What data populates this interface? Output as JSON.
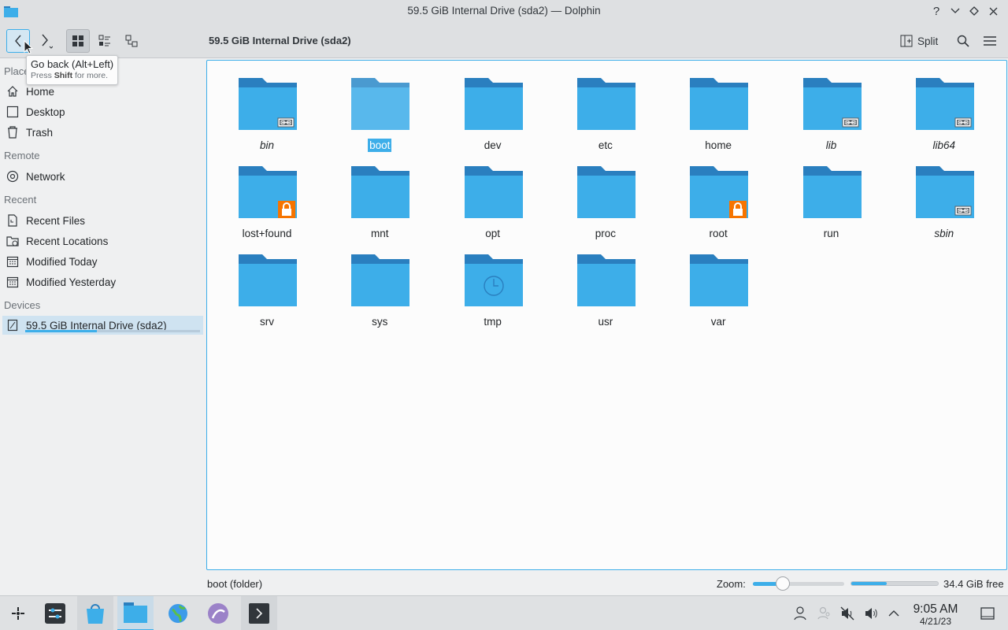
{
  "window": {
    "title": "59.5 GiB Internal Drive (sda2) — Dolphin",
    "help_glyph": "?"
  },
  "toolbar": {
    "breadcrumb": "59.5 GiB Internal Drive (sda2)",
    "split_label": "Split"
  },
  "tooltip": {
    "line1": "Go back (Alt+Left)",
    "line2_pre": "Press ",
    "line2_bold": "Shift",
    "line2_post": " for more."
  },
  "sidebar": {
    "places_header": "Places",
    "places": [
      {
        "label": "Home",
        "icon": "home-icon"
      },
      {
        "label": "Desktop",
        "icon": "desktop-icon"
      },
      {
        "label": "Trash",
        "icon": "trash-icon"
      }
    ],
    "remote_header": "Remote",
    "remote": [
      {
        "label": "Network",
        "icon": "network-icon"
      }
    ],
    "recent_header": "Recent",
    "recent": [
      {
        "label": "Recent Files",
        "icon": "recent-files-icon"
      },
      {
        "label": "Recent Locations",
        "icon": "recent-locations-icon"
      },
      {
        "label": "Modified Today",
        "icon": "calendar-icon"
      },
      {
        "label": "Modified Yesterday",
        "icon": "calendar-icon"
      }
    ],
    "devices_header": "Devices",
    "devices": [
      {
        "label": "59.5 GiB Internal Drive (sda2)",
        "icon": "drive-icon",
        "used_fraction": 0.41
      }
    ]
  },
  "folders": [
    {
      "name": "bin",
      "badge": "symlink",
      "italic": true
    },
    {
      "name": "boot",
      "badge": "",
      "italic": false,
      "selected": true
    },
    {
      "name": "dev",
      "badge": "",
      "italic": false
    },
    {
      "name": "etc",
      "badge": "",
      "italic": false
    },
    {
      "name": "home",
      "badge": "",
      "italic": false
    },
    {
      "name": "lib",
      "badge": "symlink",
      "italic": true
    },
    {
      "name": "lib64",
      "badge": "symlink",
      "italic": true
    },
    {
      "name": "lost+found",
      "badge": "lock",
      "italic": false
    },
    {
      "name": "mnt",
      "badge": "",
      "italic": false
    },
    {
      "name": "opt",
      "badge": "",
      "italic": false
    },
    {
      "name": "proc",
      "badge": "",
      "italic": false
    },
    {
      "name": "root",
      "badge": "lock",
      "italic": false
    },
    {
      "name": "run",
      "badge": "",
      "italic": false
    },
    {
      "name": "sbin",
      "badge": "symlink",
      "italic": true
    },
    {
      "name": "srv",
      "badge": "",
      "italic": false
    },
    {
      "name": "sys",
      "badge": "",
      "italic": false
    },
    {
      "name": "tmp",
      "badge": "clock",
      "italic": false
    },
    {
      "name": "usr",
      "badge": "",
      "italic": false
    },
    {
      "name": "var",
      "badge": "",
      "italic": false
    }
  ],
  "statusbar": {
    "selection_text": "boot (folder)",
    "zoom_label": "Zoom:",
    "zoom_fraction": 0.33,
    "free_space_text": "34.4 GiB free",
    "used_fraction": 0.41
  },
  "taskbar": {
    "clock_time": "9:05 AM",
    "clock_date": "4/21/23"
  },
  "colors": {
    "accent": "#3daee9",
    "folder_body": "#3daee9",
    "folder_tab": "#2a7fbf",
    "lock_badge": "#f67400"
  }
}
